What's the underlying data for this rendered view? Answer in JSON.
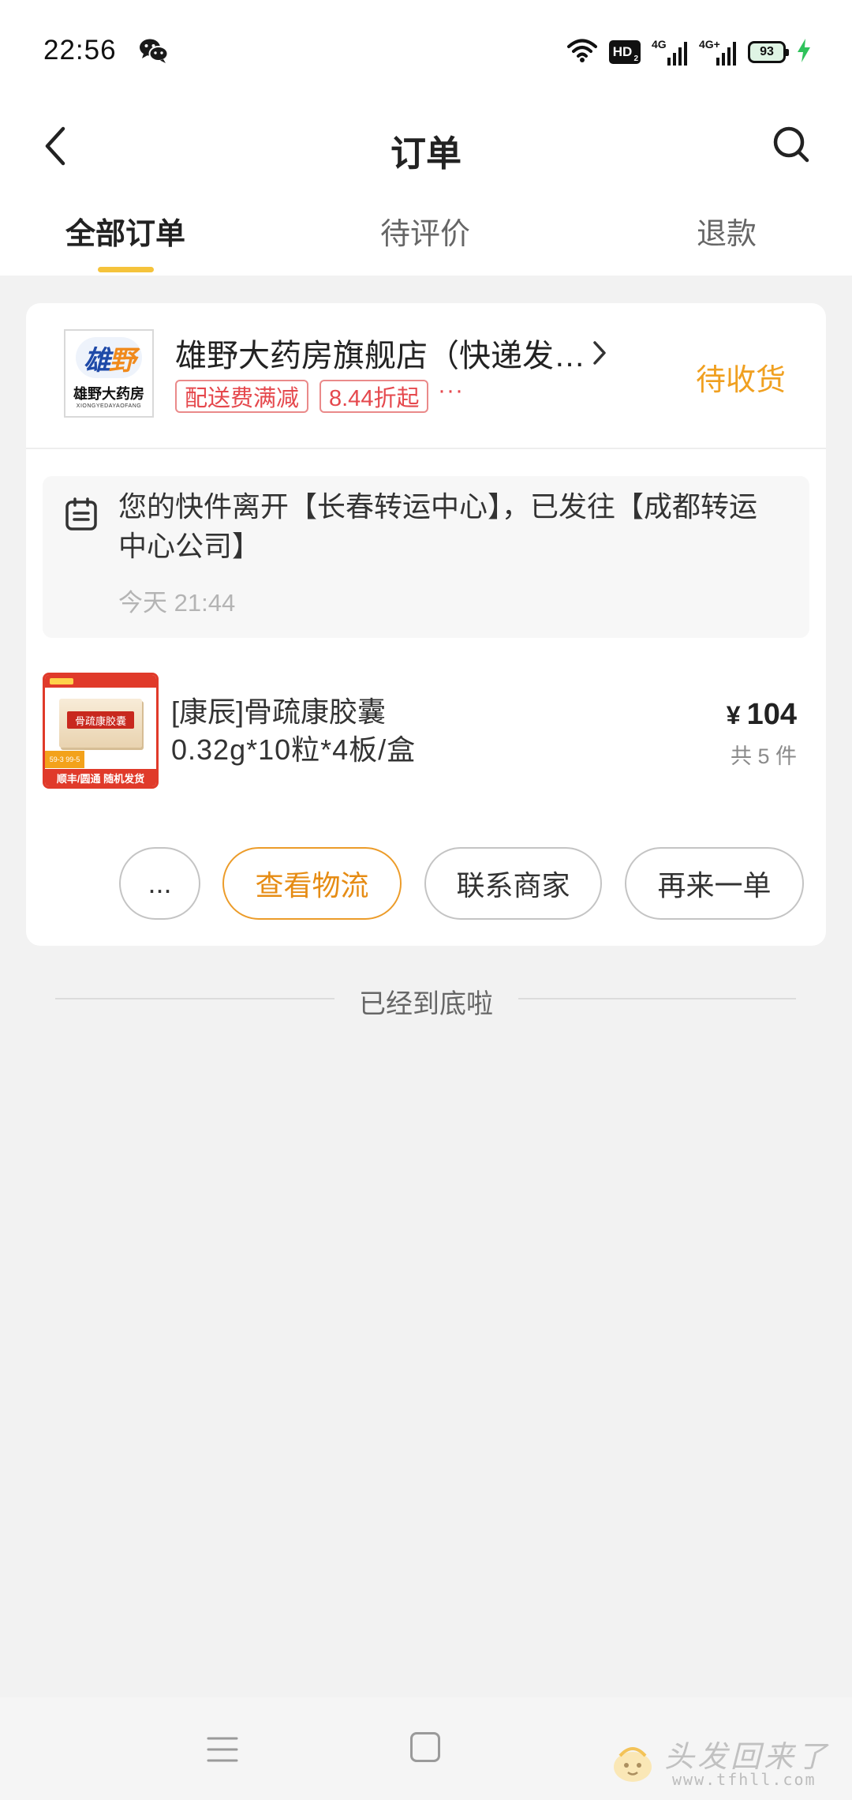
{
  "status_bar": {
    "time": "22:56",
    "hd_label": "HD",
    "hd_sub": "2",
    "net1_label": "4G",
    "net2_label": "4G+",
    "battery_level": "93",
    "icons": [
      "wechat-icon",
      "wifi-icon",
      "hd-voice-icon",
      "signal-icon",
      "signal-icon",
      "battery-icon",
      "charging-icon"
    ]
  },
  "header": {
    "title": "订单",
    "icons": {
      "back": "back-arrow-icon",
      "search": "search-icon"
    }
  },
  "tabs": [
    {
      "label": "全部订单",
      "active": true
    },
    {
      "label": "待评价",
      "active": false
    },
    {
      "label": "退款",
      "active": false
    }
  ],
  "order": {
    "store": {
      "logo_mark_1": "雄",
      "logo_mark_2": "野",
      "logo_name": "雄野大药房",
      "logo_pinyin": "XIONGYEDAYAOFANG",
      "name": "雄野大药房旗舰店（快递发…",
      "tags": [
        "配送费满减",
        "8.44折起"
      ],
      "tags_more": "···"
    },
    "status": "待收货",
    "logistics": {
      "icon": "logistics-clipboard-icon",
      "text": "您的快件离开【长春转运中心】，已发往【成都转运中心公司】",
      "time": "今天 21:44"
    },
    "product": {
      "image": {
        "box_label": "骨疏康胶囊",
        "promo": "59-3 99-5",
        "ribbon": "顺丰/圆通 随机发货"
      },
      "title": "[康辰]骨疏康胶囊",
      "spec": "0.32g*10粒*4板/盒",
      "price_symbol": "¥",
      "price": "104",
      "quantity": "共 5 件"
    },
    "actions": {
      "more": "...",
      "track": "查看物流",
      "contact": "联系商家",
      "reorder": "再来一单"
    }
  },
  "list_end_text": "已经到底啦",
  "nav_bar": {
    "icons": [
      "menu-icon",
      "home-square-icon"
    ]
  },
  "watermark": {
    "name": "头发回来了",
    "url": "www.tfhll.com"
  },
  "colors": {
    "background": "#f2f2f2",
    "accent_orange": "#f0a020",
    "tab_indicator": "#f5c33b",
    "tag_red": "#e5484d",
    "charging_green": "#2fc25b"
  }
}
